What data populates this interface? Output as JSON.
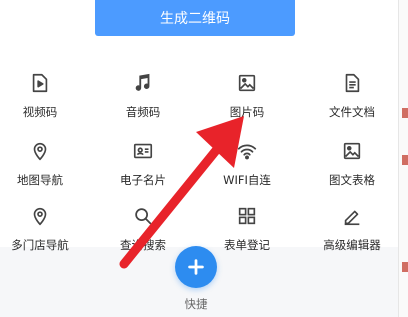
{
  "header": {
    "generate_label": "生成二维码"
  },
  "grid": [
    {
      "label": "视频码",
      "icon": "video-icon"
    },
    {
      "label": "音频码",
      "icon": "music-note-icon"
    },
    {
      "label": "图片码",
      "icon": "image-icon"
    },
    {
      "label": "文件文档",
      "icon": "document-icon"
    },
    {
      "label": "地图导航",
      "icon": "map-pin-icon"
    },
    {
      "label": "电子名片",
      "icon": "business-card-icon"
    },
    {
      "label": "WIFI自连",
      "icon": "wifi-icon"
    },
    {
      "label": "图文表格",
      "icon": "image-table-icon"
    },
    {
      "label": "多门店导航",
      "icon": "multi-store-pin-icon"
    },
    {
      "label": "查询搜索",
      "icon": "search-icon"
    },
    {
      "label": "表单登记",
      "icon": "grid-form-icon"
    },
    {
      "label": "高级编辑器",
      "icon": "pen-edit-icon"
    }
  ],
  "quick": {
    "label": "快捷"
  },
  "colors": {
    "accent": "#4c9bff",
    "fab": "#2d8cf0",
    "arrow": "#e8232a"
  }
}
